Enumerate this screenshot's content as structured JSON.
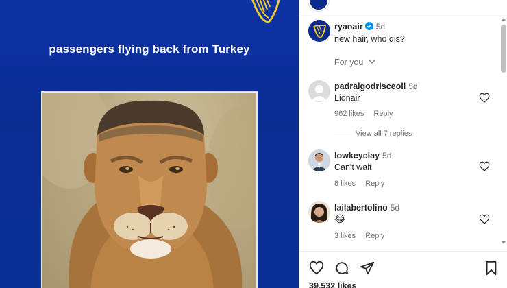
{
  "post": {
    "caption_overlay": "passengers flying back from Turkey"
  },
  "caption": {
    "username": "ryanair",
    "time": "5d",
    "text": "new hair, who dis?"
  },
  "filter": {
    "label": "For you"
  },
  "comments": [
    {
      "username": "padraigodrisceoil",
      "time": "5d",
      "text": "Lionair",
      "likes": "962 likes",
      "reply": "Reply"
    },
    {
      "username": "lowkeyclay",
      "time": "5d",
      "text": "Can't wait",
      "likes": "8 likes",
      "reply": "Reply"
    },
    {
      "username": "lailabertolino",
      "time": "5d",
      "text": "😂",
      "likes": "3 likes",
      "reply": "Reply"
    }
  ],
  "view_replies": "View all 7 replies",
  "footer": {
    "likes": "39,532 likes"
  },
  "icons": {
    "like": "heart-icon",
    "comment": "comment-icon",
    "share": "share-icon",
    "save": "bookmark-icon"
  },
  "colors": {
    "brand_blue": "#0d32a3",
    "verified": "#0095f6",
    "harp_yellow": "#f1c933"
  }
}
